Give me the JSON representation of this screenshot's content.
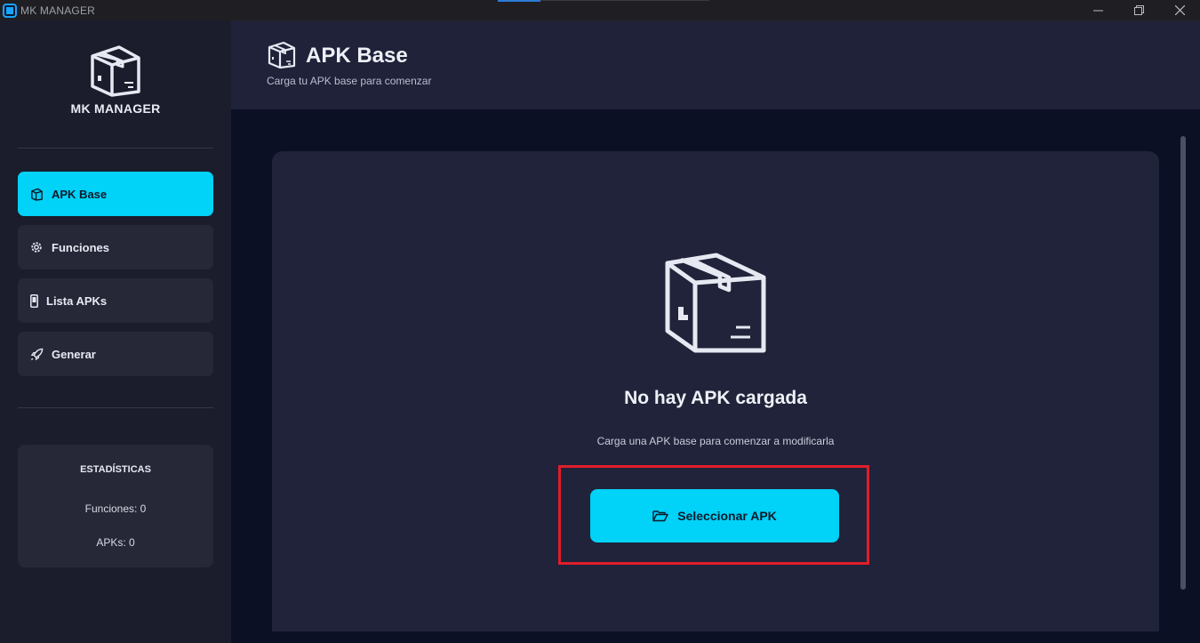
{
  "window": {
    "title": "MK MANAGER"
  },
  "sidebar": {
    "brand": "MK MANAGER",
    "items": [
      {
        "label": "APK Base",
        "icon": "box-icon",
        "active": true
      },
      {
        "label": "Funciones",
        "icon": "gear-icon",
        "active": false
      },
      {
        "label": "Lista APKs",
        "icon": "phone-icon",
        "active": false
      },
      {
        "label": "Generar",
        "icon": "rocket-icon",
        "active": false
      }
    ],
    "stats": {
      "title": "ESTADÍSTICAS",
      "funciones": "Funciones: 0",
      "apks": "APKs: 0"
    }
  },
  "header": {
    "title": "APK Base",
    "subtitle": "Carga tu APK base para comenzar"
  },
  "empty_state": {
    "title": "No hay APK cargada",
    "subtitle": "Carga una APK base para comenzar a modificarla",
    "button_label": "Seleccionar APK"
  },
  "colors": {
    "accent": "#00d2f8",
    "sidebar_bg": "#1b1d2c",
    "card_bg": "#202339",
    "highlight": "#e01e2a"
  }
}
